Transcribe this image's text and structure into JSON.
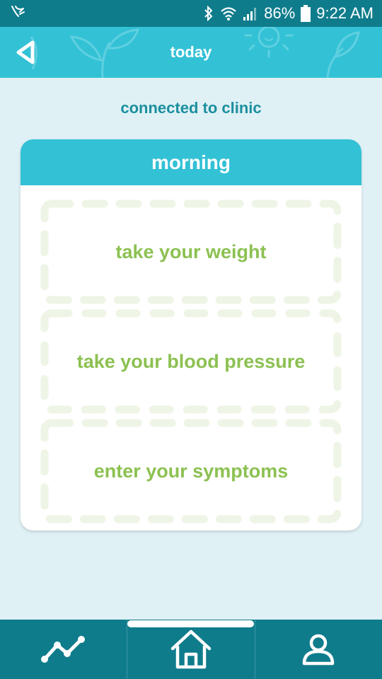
{
  "status_bar": {
    "battery": "86%",
    "time": "9:22 AM"
  },
  "header": {
    "title": "today"
  },
  "subtitle": "connected to clinic",
  "card": {
    "title": "morning",
    "tasks": [
      {
        "label": "take your weight"
      },
      {
        "label": "take your blood pressure"
      },
      {
        "label": "enter your symptoms"
      }
    ]
  },
  "bottom_nav": {
    "items": [
      {
        "icon": "trend-chart-icon"
      },
      {
        "icon": "home-icon",
        "selected": true
      },
      {
        "icon": "profile-icon"
      }
    ]
  },
  "colors": {
    "status_bar": "#0f7c8c",
    "app_bar": "#33c1d6",
    "background": "#dff1f5",
    "accent_text": "#1b8f9f",
    "task_text": "#8cc152",
    "dashed_border": "#eef5e6"
  }
}
